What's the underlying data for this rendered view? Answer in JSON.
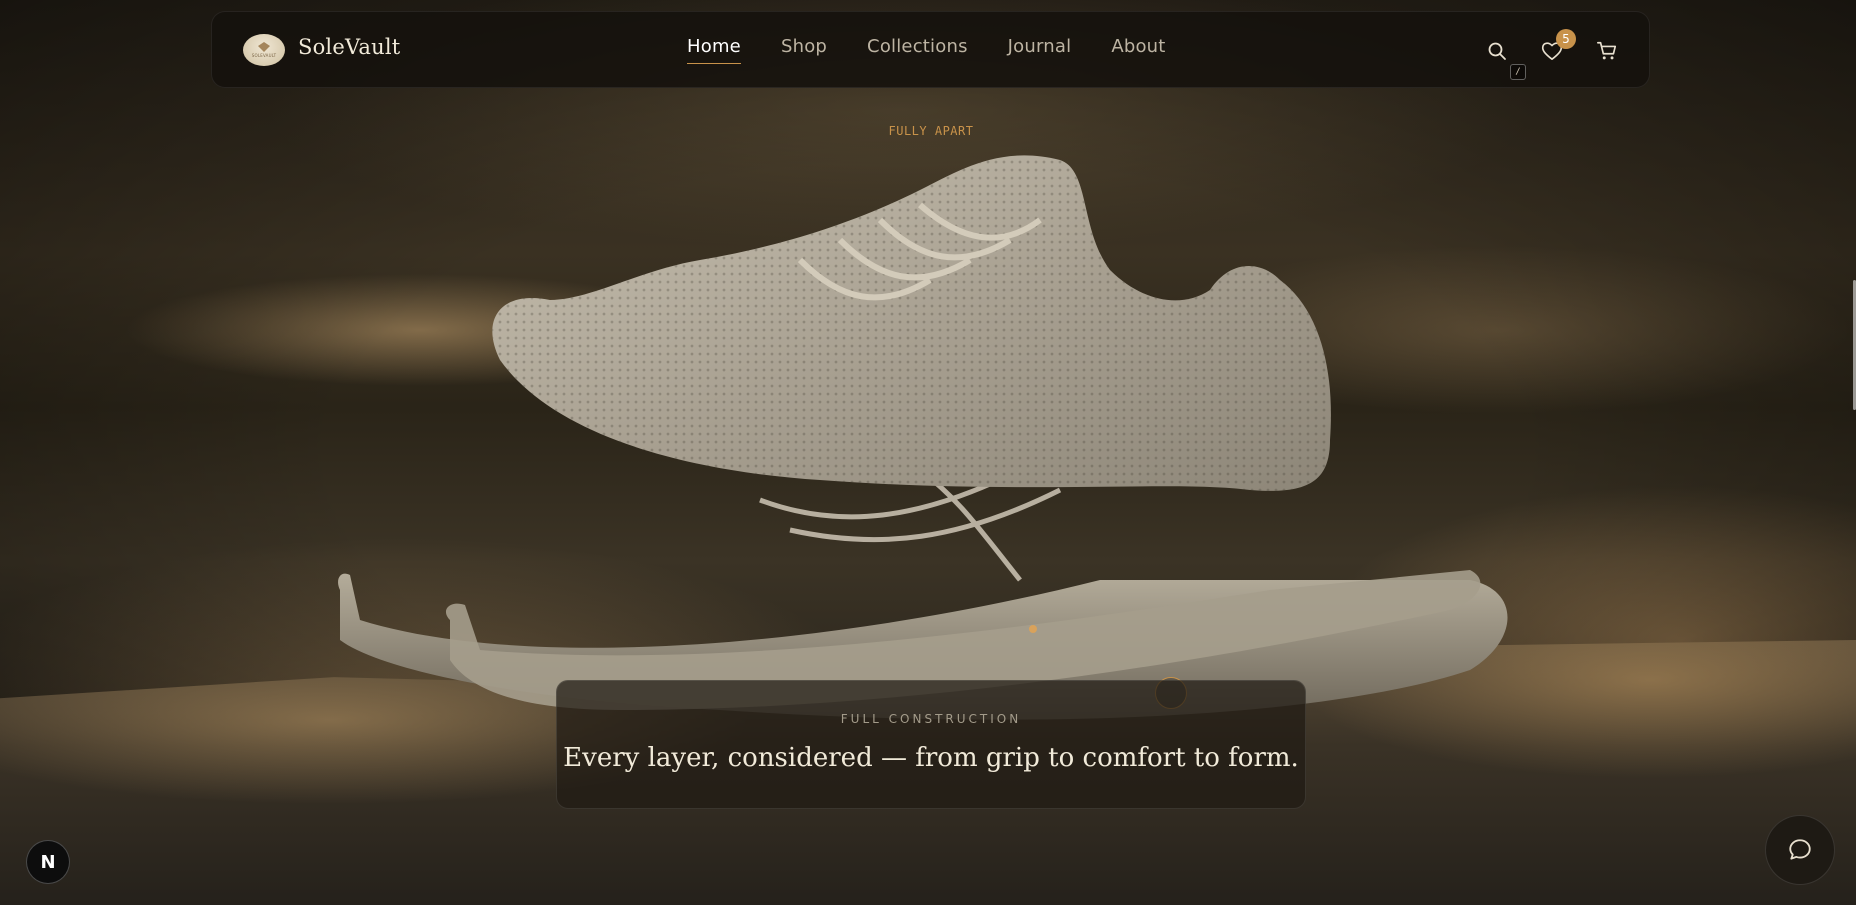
{
  "header": {
    "brand": "SoleVault",
    "logo_text": "SOLEVAULT",
    "nav": [
      {
        "label": "Home",
        "active": true
      },
      {
        "label": "Shop",
        "active": false
      },
      {
        "label": "Collections",
        "active": false
      },
      {
        "label": "Journal",
        "active": false
      },
      {
        "label": "About",
        "active": false
      }
    ],
    "search_shortcut": "/",
    "wishlist_count": "5",
    "icons": {
      "search": "search-icon",
      "wishlist": "heart-icon",
      "cart": "cart-icon"
    }
  },
  "hero": {
    "eyebrow": "FULLY APART",
    "caption": {
      "kicker": "FULL CONSTRUCTION",
      "headline": "Every layer, considered — from grip to comfort to form."
    }
  },
  "floating": {
    "next_badge": "N",
    "chat_icon": "chat-icon"
  },
  "colors": {
    "accent": "#c8924a",
    "nav_active": "#ffffff",
    "nav_inactive": "#bdb4a3",
    "header_bg": "#14110c",
    "text_light": "#f1ead9"
  }
}
